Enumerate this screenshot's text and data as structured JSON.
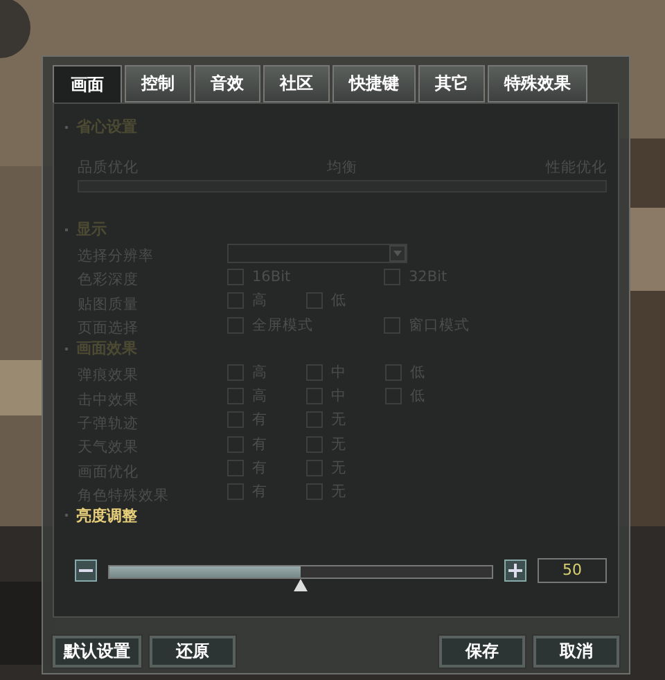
{
  "tabs": [
    {
      "label": "画面",
      "selected": true
    },
    {
      "label": "控制",
      "selected": false
    },
    {
      "label": "音效",
      "selected": false
    },
    {
      "label": "社区",
      "selected": false
    },
    {
      "label": "快捷键",
      "selected": false
    },
    {
      "label": "其它",
      "selected": false
    },
    {
      "label": "特殊效果",
      "selected": false
    }
  ],
  "easy": {
    "title": "省心设置",
    "disabled": true,
    "labels": [
      "品质优化",
      "均衡",
      "性能优化"
    ]
  },
  "display": {
    "title": "显示",
    "disabled": true,
    "rows": [
      {
        "label": "选择分辨率",
        "kind": "dropdown",
        "options": []
      },
      {
        "label": "色彩深度",
        "kind": "wide",
        "options": [
          "16Bit",
          "32Bit"
        ]
      },
      {
        "label": "贴图质量",
        "kind": "narrow",
        "options": [
          "高",
          "低"
        ]
      },
      {
        "label": "页面选择",
        "kind": "wide",
        "options": [
          "全屏模式",
          "窗口模式"
        ]
      }
    ]
  },
  "effects": {
    "title": "画面效果",
    "disabled": true,
    "rows": [
      {
        "label": "弹痕效果",
        "kind": "narrow",
        "options": [
          "高",
          "中",
          "低"
        ]
      },
      {
        "label": "击中效果",
        "kind": "narrow",
        "options": [
          "高",
          "中",
          "低"
        ]
      },
      {
        "label": "子弹轨迹",
        "kind": "narrow",
        "options": [
          "有",
          "无"
        ]
      },
      {
        "label": "天气效果",
        "kind": "narrow",
        "options": [
          "有",
          "无"
        ]
      },
      {
        "label": "画面优化",
        "kind": "narrow",
        "options": [
          "有",
          "无"
        ]
      },
      {
        "label": "角色特殊效果",
        "kind": "narrow",
        "options": [
          "有",
          "无"
        ]
      }
    ]
  },
  "brightness": {
    "title": "亮度调整",
    "disabled": false,
    "level": 0.5,
    "value": "50"
  },
  "buttons_left": [
    "默认设置",
    "还原"
  ],
  "buttons_right": [
    "保存",
    "取消"
  ]
}
